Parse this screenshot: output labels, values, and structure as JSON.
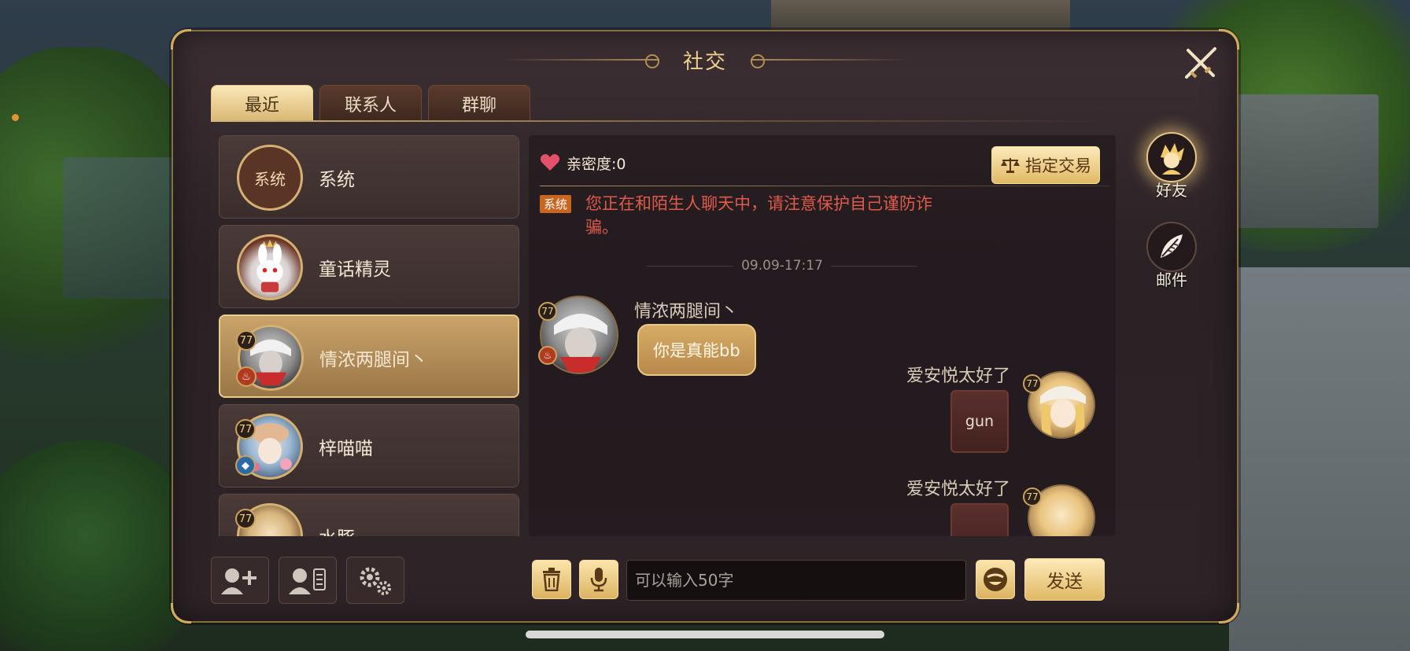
{
  "window": {
    "title": "社交",
    "close_icon": "crossed-swords-close-icon"
  },
  "tabs": [
    {
      "label": "最近",
      "active": true
    },
    {
      "label": "联系人",
      "active": false
    },
    {
      "label": "群聊",
      "active": false
    }
  ],
  "contacts": [
    {
      "name": "系统",
      "avatar_text": "系统"
    },
    {
      "name": "童话精灵",
      "avatar_icon": "white-rabbit-crown-icon"
    },
    {
      "name": "情浓两腿间丶",
      "level": "77",
      "element": "fire",
      "active": true
    },
    {
      "name": "梓喵喵",
      "level": "77",
      "element": "water"
    },
    {
      "name": "水豚",
      "level": "77"
    }
  ],
  "chat": {
    "intimacy_label": "亲密度:0",
    "trade_button": "指定交易",
    "system_tag": "系统",
    "system_message": "您正在和陌生人聊天中，请注意保护自己谨防诈骗。",
    "timestamp": "09.09-17:17",
    "messages": [
      {
        "sender": "情浓两腿间丶",
        "text": "你是真能bb",
        "level": "77",
        "side": "left"
      },
      {
        "sender": "爱安悦太好了",
        "text": "gun",
        "level": "77",
        "side": "right"
      },
      {
        "sender": "爱安悦太好了",
        "text": "",
        "level": "77",
        "side": "right"
      }
    ]
  },
  "input": {
    "placeholder": "可以输入50字",
    "value": ""
  },
  "buttons": {
    "send": "发送"
  },
  "side_nav": [
    {
      "label": "好友",
      "icon": "friend-icon",
      "active": true
    },
    {
      "label": "邮件",
      "icon": "mail-quill-icon",
      "active": false
    }
  ],
  "colors": {
    "accent_gold": "#e0b964",
    "panel_bg": "#2b2226",
    "system_red": "#e05a49"
  }
}
